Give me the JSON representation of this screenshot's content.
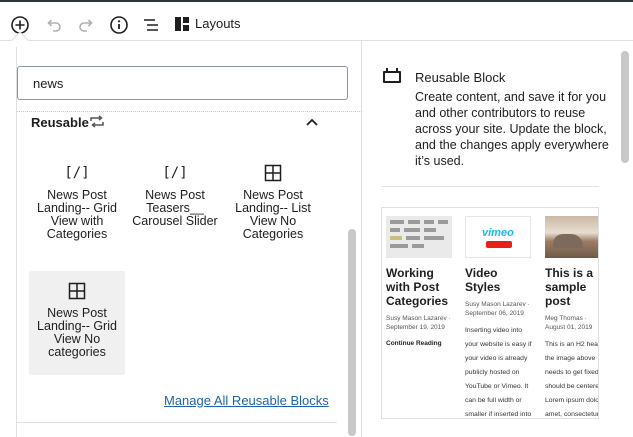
{
  "toolbar": {
    "layouts_label": "Layouts",
    "icons": [
      "add-block-icon",
      "undo-icon",
      "redo-icon",
      "info-icon",
      "list-view-icon",
      "layouts-icon"
    ]
  },
  "search": {
    "value": "news"
  },
  "group": {
    "label": "Reusable",
    "items": [
      {
        "icon": "[/]",
        "label": "News Post Landing-- Grid View with Categories"
      },
      {
        "icon": "[/]",
        "label": "News Post Teasers__ Carousel Slider"
      },
      {
        "icon": "grid",
        "label": "News Post Landing-- List View No Categories"
      },
      {
        "icon": "grid",
        "label": "News Post Landing-- Grid View No categories"
      }
    ],
    "manage_link": "Manage All Reusable Blocks"
  },
  "preview": {
    "title": "Reusable Block",
    "description": "Create content, and save it for you and other contributors to reuse across your site. Update the block, and the changes apply everywhere it’s used.",
    "posts": [
      {
        "title": "Working with Post Categories",
        "author": "Susy Mason Lazarev ·",
        "date": "September 19, 2019",
        "extra": "Continue Reading"
      },
      {
        "title": "Video Styles",
        "author": "Susy Mason Lazarev ·",
        "date": "September 06, 2019",
        "extra": "Inserting video into your website is easy if your video is already publicly hosted on YouTube or Vimeo. It can be full width or smaller if inserted into a"
      },
      {
        "title": "This is a sample post",
        "author": "Meg Thomas ·",
        "date": "August 01, 2019",
        "extra": "This is an H2 headline the image above needs to get fixed. It should be centered. Lorem ipsum dolor sit amet, consectetur"
      }
    ],
    "vimeo_text": "vimeo"
  },
  "colors": {
    "accent": "#1e64a8",
    "text": "#1e1e1e",
    "border": "#e0e0e0"
  }
}
